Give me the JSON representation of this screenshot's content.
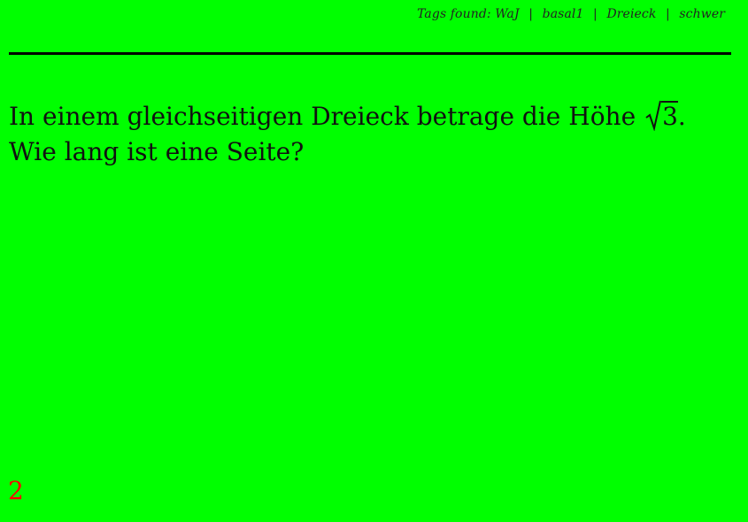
{
  "header": {
    "tags_prefix": "Tags found:",
    "tags": [
      "WaJ",
      "basal1",
      "Dreieck",
      "schwer"
    ],
    "separator": "|"
  },
  "question": {
    "text_before": "In einem gleichseitigen Dreieck betrage die Höhe ",
    "radicand": "3",
    "text_after": ". Wie lang ist eine Seite?"
  },
  "footer": {
    "page_number": "2"
  },
  "colors": {
    "background": "#00ff00",
    "page_number": "#ff0000"
  }
}
